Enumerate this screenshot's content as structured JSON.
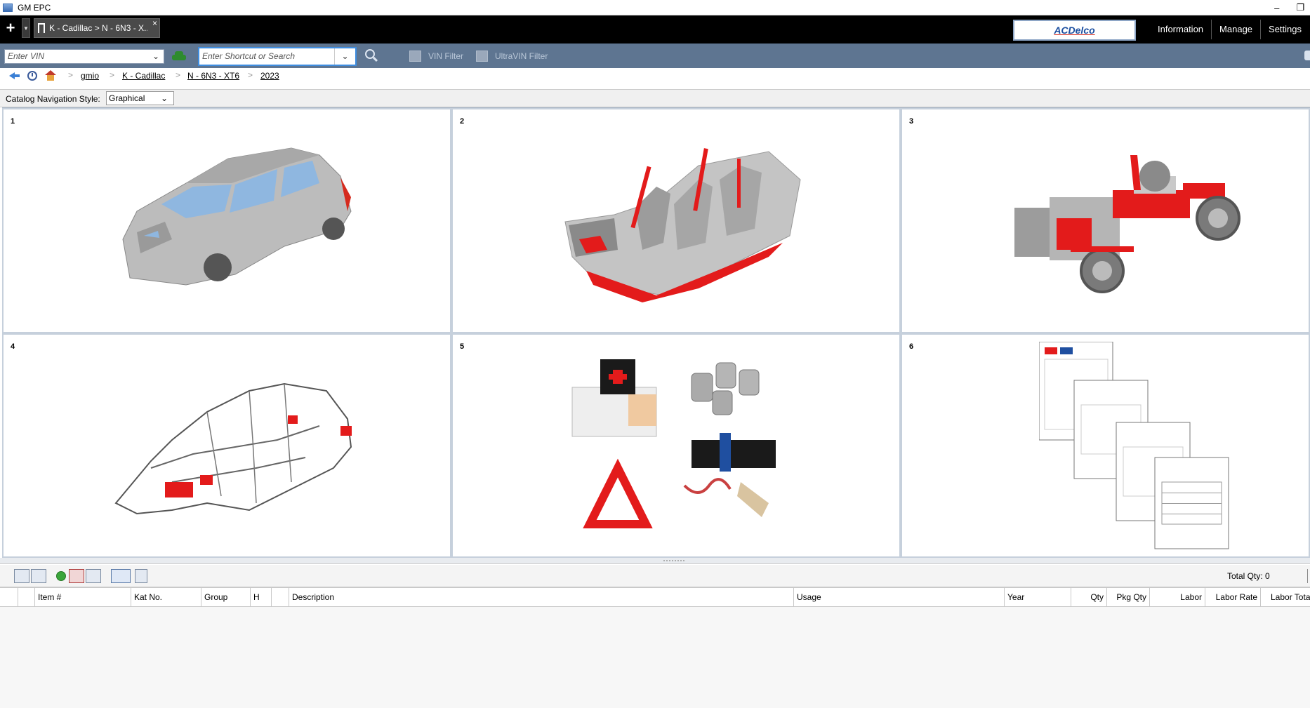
{
  "window": {
    "title": "GM EPC",
    "minimize": "–",
    "restore": "❐"
  },
  "tabbar": {
    "add": "+",
    "tab_label": "K - Cadillac > N - 6N3 - X...",
    "tab_close": "×",
    "brand": "ACDelco",
    "nav": [
      "Information",
      "Manage",
      "Settings"
    ]
  },
  "toolbar": {
    "vin_placeholder": "Enter VIN",
    "search_placeholder": "Enter Shortcut or Search",
    "vin_filter": "VIN Filter",
    "ultravin_filter": "UltraVIN Filter"
  },
  "breadcrumb": [
    "gmio",
    "K - Cadillac",
    "N - 6N3 - XT6",
    "2023"
  ],
  "nav_style": {
    "label": "Catalog Navigation Style:",
    "value": "Graphical"
  },
  "catalog": {
    "cells": [
      {
        "num": "1"
      },
      {
        "num": "2"
      },
      {
        "num": "3"
      },
      {
        "num": "4"
      },
      {
        "num": "5"
      },
      {
        "num": "6"
      }
    ]
  },
  "bottom": {
    "total_qty": "Total Qty: 0"
  },
  "table": {
    "columns": [
      "Item #",
      "Kat No.",
      "Group",
      "H",
      "Description",
      "Usage",
      "Year",
      "Qty",
      "Pkg Qty",
      "Labor",
      "Labor Rate",
      "Labor Total"
    ]
  },
  "colors": {
    "accent": "#3e8de0",
    "toolbar": "#5e7591",
    "highlight": "#e31b1b",
    "body": "#bfbfbf"
  }
}
